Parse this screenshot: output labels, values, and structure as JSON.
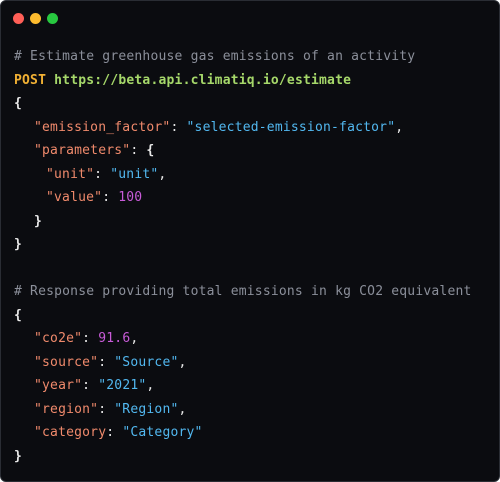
{
  "window": {
    "controls": {
      "close_color": "#ff5f57",
      "minimize_color": "#febc2e",
      "maximize_color": "#28c840"
    }
  },
  "request": {
    "comment": "# Estimate greenhouse gas emissions of an activity",
    "method": "POST",
    "url": "https://beta.api.climatiq.io/estimate",
    "open_brace": "{",
    "close_brace": "}",
    "emission_factor_key": "\"emission_factor\"",
    "emission_factor_value": "\"selected-emission-factor\"",
    "parameters_key": "\"parameters\"",
    "parameters_open": "{",
    "parameters_close": "}",
    "unit_key": "\"unit\"",
    "unit_value": "\"unit\"",
    "value_key": "\"value\"",
    "value_value": "100"
  },
  "response": {
    "comment": "# Response providing total emissions in kg CO2 equivalent",
    "open_brace": "{",
    "close_brace": "}",
    "co2e_key": "\"co2e\"",
    "co2e_value": "91.6",
    "source_key": "\"source\"",
    "source_value": "\"Source\"",
    "year_key": "\"year\"",
    "year_value": "\"2021\"",
    "region_key": "\"region\"",
    "region_value": "\"Region\"",
    "category_key": "\"category",
    "category_value": "\"Category\""
  },
  "syntax_colors": {
    "background": "#0b0c10",
    "comment": "#8b8f9a",
    "method": "#f2b134",
    "url": "#a6d86a",
    "key": "#f08a6c",
    "string": "#52b8f0",
    "number": "#c85bd8"
  }
}
